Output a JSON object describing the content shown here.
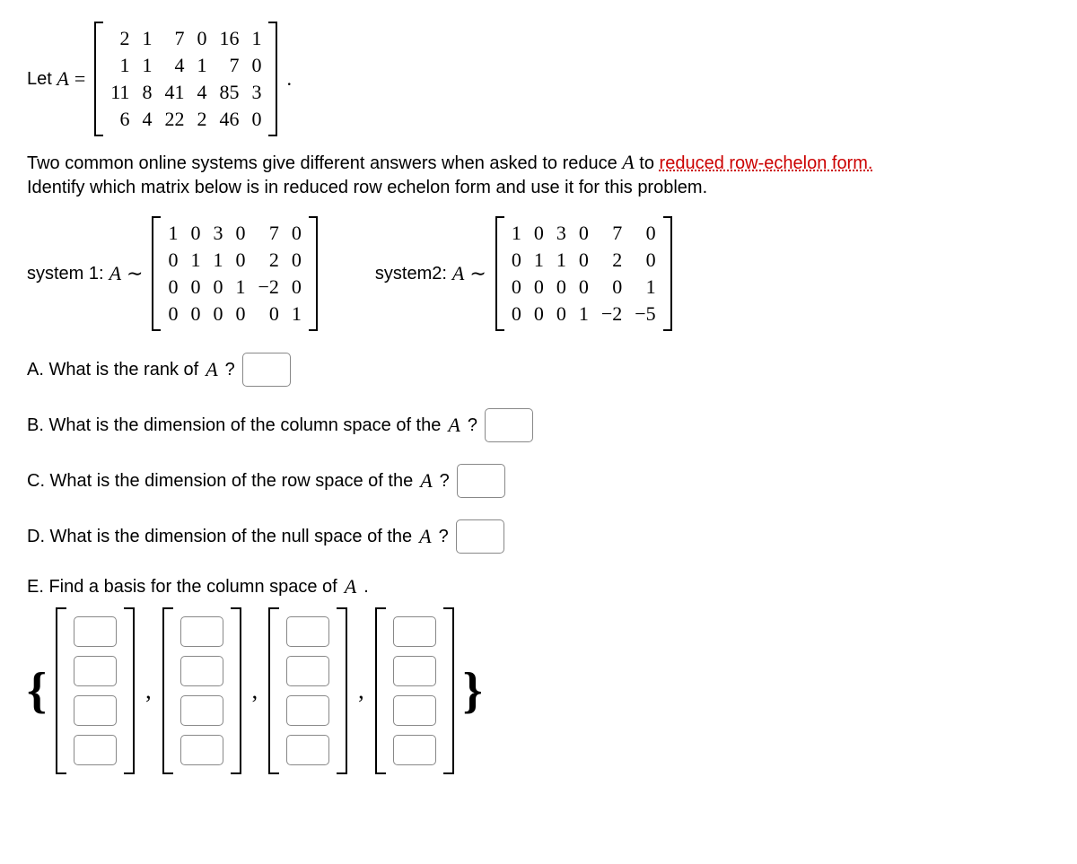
{
  "intro": {
    "let": "Let",
    "var": "A",
    "eq": "=",
    "period": "."
  },
  "matrixA": [
    [
      "2",
      "1",
      "7",
      "0",
      "16",
      "1"
    ],
    [
      "1",
      "1",
      "4",
      "1",
      "7",
      "0"
    ],
    [
      "11",
      "8",
      "41",
      "4",
      "85",
      "3"
    ],
    [
      "6",
      "4",
      "22",
      "2",
      "46",
      "0"
    ]
  ],
  "desc": {
    "line1a": "Two common online systems give different answers when asked to reduce ",
    "var": "A",
    "line1b": " to ",
    "link": "reduced row-echelon form.",
    "line2": "Identify which matrix below is in reduced row echelon form and use it for this problem."
  },
  "systems": {
    "s1label": "system 1:",
    "s2label": "system2:",
    "tilde": "∼",
    "m1": [
      [
        "1",
        "0",
        "3",
        "0",
        "7",
        "0"
      ],
      [
        "0",
        "1",
        "1",
        "0",
        "2",
        "0"
      ],
      [
        "0",
        "0",
        "0",
        "1",
        "−2",
        "0"
      ],
      [
        "0",
        "0",
        "0",
        "0",
        "0",
        "1"
      ]
    ],
    "m2": [
      [
        "1",
        "0",
        "3",
        "0",
        "7",
        "0"
      ],
      [
        "0",
        "1",
        "1",
        "0",
        "2",
        "0"
      ],
      [
        "0",
        "0",
        "0",
        "0",
        "0",
        "1"
      ],
      [
        "0",
        "0",
        "0",
        "1",
        "−2",
        "−5"
      ]
    ]
  },
  "questions": {
    "A": {
      "pre": "A. What is the rank of ",
      "var": "A",
      "post": " ?"
    },
    "B": {
      "pre": "B. What is the dimension of the column space of the ",
      "var": "A",
      "post": " ?"
    },
    "C": {
      "pre": "C. What is the dimension of the row space of the ",
      "var": "A",
      "post": " ?"
    },
    "D": {
      "pre": "D. What is the dimension of the null space of the ",
      "var": "A",
      "post": " ?"
    },
    "E": {
      "pre": "E. Find a basis for the column space of ",
      "var": "A",
      "post": " ."
    }
  },
  "braces": {
    "open": "{",
    "close": "}",
    "comma": ","
  }
}
